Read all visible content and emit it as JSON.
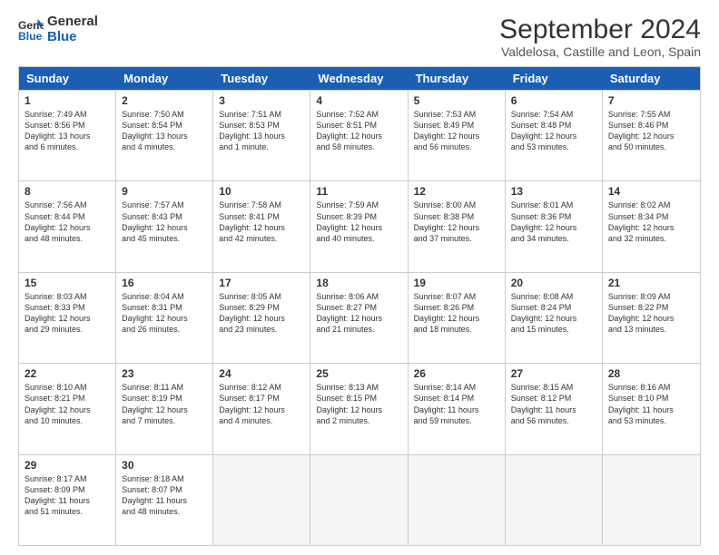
{
  "logo": {
    "line1": "General",
    "line2": "Blue"
  },
  "title": "September 2024",
  "subtitle": "Valdelosa, Castille and Leon, Spain",
  "days": [
    "Sunday",
    "Monday",
    "Tuesday",
    "Wednesday",
    "Thursday",
    "Friday",
    "Saturday"
  ],
  "rows": [
    [
      {
        "day": "1",
        "lines": [
          "Sunrise: 7:49 AM",
          "Sunset: 8:56 PM",
          "Daylight: 13 hours",
          "and 6 minutes."
        ]
      },
      {
        "day": "2",
        "lines": [
          "Sunrise: 7:50 AM",
          "Sunset: 8:54 PM",
          "Daylight: 13 hours",
          "and 4 minutes."
        ]
      },
      {
        "day": "3",
        "lines": [
          "Sunrise: 7:51 AM",
          "Sunset: 8:53 PM",
          "Daylight: 13 hours",
          "and 1 minute."
        ]
      },
      {
        "day": "4",
        "lines": [
          "Sunrise: 7:52 AM",
          "Sunset: 8:51 PM",
          "Daylight: 12 hours",
          "and 58 minutes."
        ]
      },
      {
        "day": "5",
        "lines": [
          "Sunrise: 7:53 AM",
          "Sunset: 8:49 PM",
          "Daylight: 12 hours",
          "and 56 minutes."
        ]
      },
      {
        "day": "6",
        "lines": [
          "Sunrise: 7:54 AM",
          "Sunset: 8:48 PM",
          "Daylight: 12 hours",
          "and 53 minutes."
        ]
      },
      {
        "day": "7",
        "lines": [
          "Sunrise: 7:55 AM",
          "Sunset: 8:46 PM",
          "Daylight: 12 hours",
          "and 50 minutes."
        ]
      }
    ],
    [
      {
        "day": "8",
        "lines": [
          "Sunrise: 7:56 AM",
          "Sunset: 8:44 PM",
          "Daylight: 12 hours",
          "and 48 minutes."
        ]
      },
      {
        "day": "9",
        "lines": [
          "Sunrise: 7:57 AM",
          "Sunset: 8:43 PM",
          "Daylight: 12 hours",
          "and 45 minutes."
        ]
      },
      {
        "day": "10",
        "lines": [
          "Sunrise: 7:58 AM",
          "Sunset: 8:41 PM",
          "Daylight: 12 hours",
          "and 42 minutes."
        ]
      },
      {
        "day": "11",
        "lines": [
          "Sunrise: 7:59 AM",
          "Sunset: 8:39 PM",
          "Daylight: 12 hours",
          "and 40 minutes."
        ]
      },
      {
        "day": "12",
        "lines": [
          "Sunrise: 8:00 AM",
          "Sunset: 8:38 PM",
          "Daylight: 12 hours",
          "and 37 minutes."
        ]
      },
      {
        "day": "13",
        "lines": [
          "Sunrise: 8:01 AM",
          "Sunset: 8:36 PM",
          "Daylight: 12 hours",
          "and 34 minutes."
        ]
      },
      {
        "day": "14",
        "lines": [
          "Sunrise: 8:02 AM",
          "Sunset: 8:34 PM",
          "Daylight: 12 hours",
          "and 32 minutes."
        ]
      }
    ],
    [
      {
        "day": "15",
        "lines": [
          "Sunrise: 8:03 AM",
          "Sunset: 8:33 PM",
          "Daylight: 12 hours",
          "and 29 minutes."
        ]
      },
      {
        "day": "16",
        "lines": [
          "Sunrise: 8:04 AM",
          "Sunset: 8:31 PM",
          "Daylight: 12 hours",
          "and 26 minutes."
        ]
      },
      {
        "day": "17",
        "lines": [
          "Sunrise: 8:05 AM",
          "Sunset: 8:29 PM",
          "Daylight: 12 hours",
          "and 23 minutes."
        ]
      },
      {
        "day": "18",
        "lines": [
          "Sunrise: 8:06 AM",
          "Sunset: 8:27 PM",
          "Daylight: 12 hours",
          "and 21 minutes."
        ]
      },
      {
        "day": "19",
        "lines": [
          "Sunrise: 8:07 AM",
          "Sunset: 8:26 PM",
          "Daylight: 12 hours",
          "and 18 minutes."
        ]
      },
      {
        "day": "20",
        "lines": [
          "Sunrise: 8:08 AM",
          "Sunset: 8:24 PM",
          "Daylight: 12 hours",
          "and 15 minutes."
        ]
      },
      {
        "day": "21",
        "lines": [
          "Sunrise: 8:09 AM",
          "Sunset: 8:22 PM",
          "Daylight: 12 hours",
          "and 13 minutes."
        ]
      }
    ],
    [
      {
        "day": "22",
        "lines": [
          "Sunrise: 8:10 AM",
          "Sunset: 8:21 PM",
          "Daylight: 12 hours",
          "and 10 minutes."
        ]
      },
      {
        "day": "23",
        "lines": [
          "Sunrise: 8:11 AM",
          "Sunset: 8:19 PM",
          "Daylight: 12 hours",
          "and 7 minutes."
        ]
      },
      {
        "day": "24",
        "lines": [
          "Sunrise: 8:12 AM",
          "Sunset: 8:17 PM",
          "Daylight: 12 hours",
          "and 4 minutes."
        ]
      },
      {
        "day": "25",
        "lines": [
          "Sunrise: 8:13 AM",
          "Sunset: 8:15 PM",
          "Daylight: 12 hours",
          "and 2 minutes."
        ]
      },
      {
        "day": "26",
        "lines": [
          "Sunrise: 8:14 AM",
          "Sunset: 8:14 PM",
          "Daylight: 11 hours",
          "and 59 minutes."
        ]
      },
      {
        "day": "27",
        "lines": [
          "Sunrise: 8:15 AM",
          "Sunset: 8:12 PM",
          "Daylight: 11 hours",
          "and 56 minutes."
        ]
      },
      {
        "day": "28",
        "lines": [
          "Sunrise: 8:16 AM",
          "Sunset: 8:10 PM",
          "Daylight: 11 hours",
          "and 53 minutes."
        ]
      }
    ],
    [
      {
        "day": "29",
        "lines": [
          "Sunrise: 8:17 AM",
          "Sunset: 8:09 PM",
          "Daylight: 11 hours",
          "and 51 minutes."
        ]
      },
      {
        "day": "30",
        "lines": [
          "Sunrise: 8:18 AM",
          "Sunset: 8:07 PM",
          "Daylight: 11 hours",
          "and 48 minutes."
        ]
      },
      {
        "day": "",
        "lines": [],
        "empty": true
      },
      {
        "day": "",
        "lines": [],
        "empty": true
      },
      {
        "day": "",
        "lines": [],
        "empty": true
      },
      {
        "day": "",
        "lines": [],
        "empty": true
      },
      {
        "day": "",
        "lines": [],
        "empty": true
      }
    ]
  ]
}
